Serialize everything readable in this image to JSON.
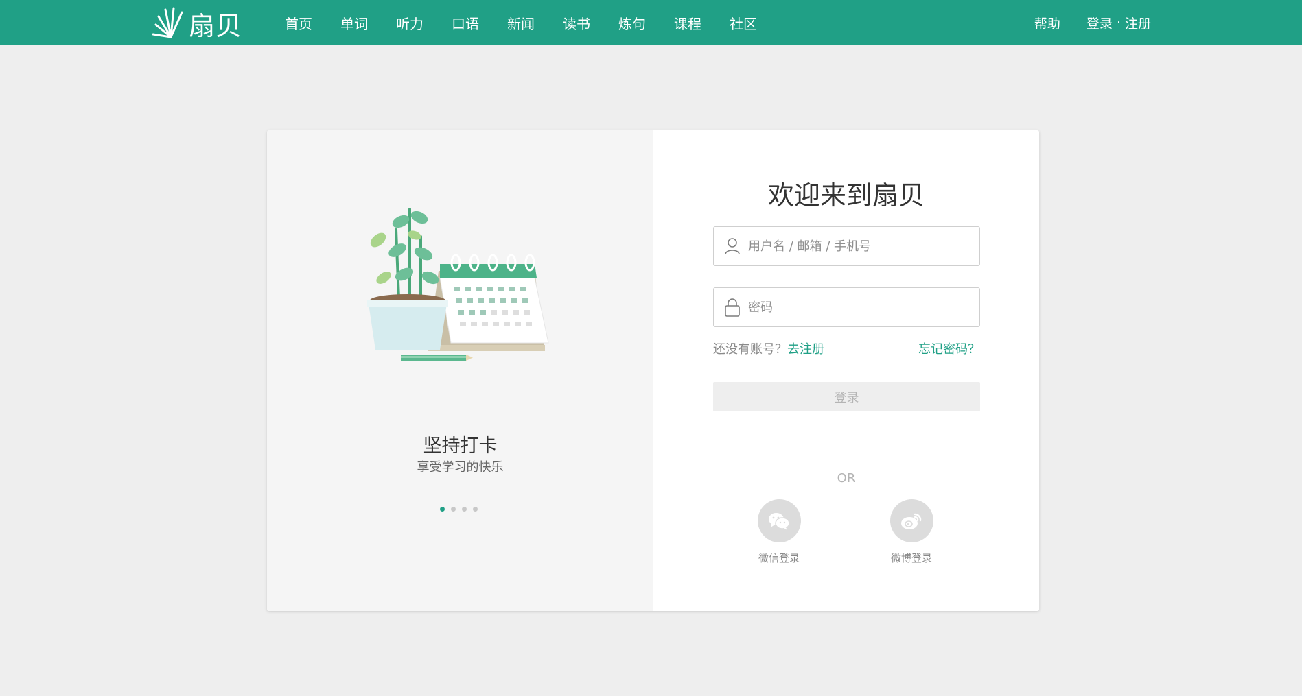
{
  "brand": {
    "logo_text": "扇贝",
    "accent_color": "#20a086"
  },
  "nav": {
    "items": [
      "首页",
      "单词",
      "听力",
      "口语",
      "新闻",
      "读书",
      "炼句",
      "课程",
      "社区"
    ],
    "help": "帮助",
    "login": "登录",
    "separator": "·",
    "register": "注册"
  },
  "carousel": {
    "title": "坚持打卡",
    "subtitle": "享受学习的快乐",
    "dot_count": 4,
    "active_index": 0
  },
  "login_form": {
    "heading": "欢迎来到扇贝",
    "username_placeholder": "用户名 / 邮箱 / 手机号",
    "password_placeholder": "密码",
    "no_account_text": "还没有账号？",
    "register_link": "去注册",
    "forgot_password": "忘记密码？",
    "submit_label": "登录",
    "or_text": "OR",
    "wechat_label": "微信登录",
    "weibo_label": "微博登录"
  },
  "icons": [
    "logo-fan-icon",
    "user-icon",
    "lock-icon",
    "wechat-icon",
    "weibo-icon"
  ]
}
